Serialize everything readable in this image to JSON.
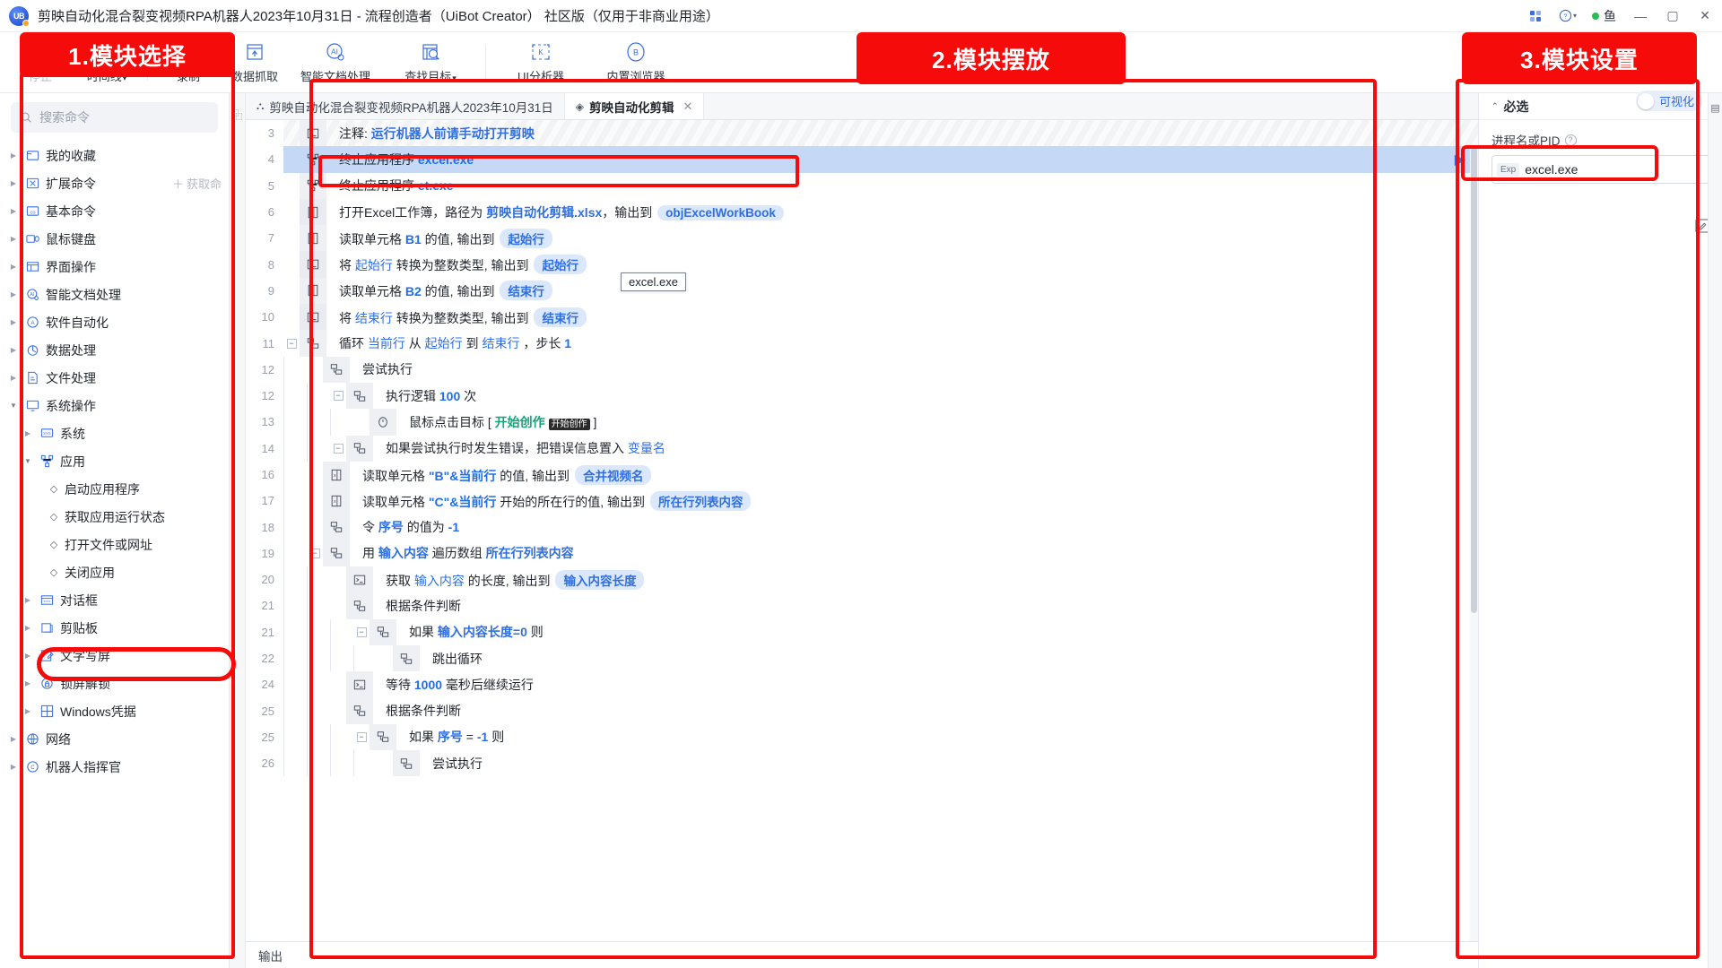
{
  "window": {
    "title": "剪映自动化混合裂变视频RPA机器人2023年10月31日 - 流程创造者（UiBot Creator） 社区版（仅用于非商业用途）",
    "logo_text": "UB",
    "user_label": "鱼",
    "minimize": "—",
    "maximize": "▢",
    "close": "✕",
    "help": "?",
    "help_caret": "▾",
    "grid_icon": "apps-grid-icon"
  },
  "toolbar": {
    "items": [
      {
        "label": "停止",
        "icon": "stop-icon",
        "disabled": true,
        "caret": false
      },
      {
        "label": "时间线",
        "icon": "timeline-icon",
        "disabled": false,
        "caret": true
      },
      {
        "label": "录制",
        "icon": "record-icon",
        "disabled": false,
        "caret": false
      },
      {
        "label": "数据抓取",
        "icon": "data-capture-icon",
        "disabled": false,
        "caret": false
      },
      {
        "label": "智能文档处理",
        "icon": "ai-document-icon",
        "disabled": false,
        "caret": false
      },
      {
        "label": "查找目标",
        "icon": "find-target-icon",
        "disabled": false,
        "caret": true
      },
      {
        "label": "UI分析器",
        "icon": "ui-analyzer-icon",
        "disabled": false,
        "caret": false
      },
      {
        "label": "内置浏览器",
        "icon": "browser-icon",
        "disabled": false,
        "caret": false
      }
    ]
  },
  "sidebar": {
    "search_placeholder": "搜索命令",
    "search_icon": "search-icon",
    "get_more_label": "获取命",
    "get_more_icon": "plus-icon",
    "items": [
      {
        "label": "我的收藏",
        "icon": "folder-icon",
        "depth": 0,
        "expanded": false,
        "leaf": false
      },
      {
        "label": "扩展命令",
        "icon": "extension-icon",
        "depth": 0,
        "expanded": false,
        "leaf": false,
        "get_more": true
      },
      {
        "label": "基本命令",
        "icon": "basic-icon",
        "depth": 0,
        "expanded": false,
        "leaf": false
      },
      {
        "label": "鼠标键盘",
        "icon": "mouse-keyboard-icon",
        "depth": 0,
        "expanded": false,
        "leaf": false
      },
      {
        "label": "界面操作",
        "icon": "ui-operation-icon",
        "depth": 0,
        "expanded": false,
        "leaf": false
      },
      {
        "label": "智能文档处理",
        "icon": "ai-document-icon",
        "depth": 0,
        "expanded": false,
        "leaf": false
      },
      {
        "label": "软件自动化",
        "icon": "software-auto-icon",
        "depth": 0,
        "expanded": false,
        "leaf": false
      },
      {
        "label": "数据处理",
        "icon": "data-process-icon",
        "depth": 0,
        "expanded": false,
        "leaf": false
      },
      {
        "label": "文件处理",
        "icon": "file-process-icon",
        "depth": 0,
        "expanded": false,
        "leaf": false
      },
      {
        "label": "系统操作",
        "icon": "system-icon",
        "depth": 0,
        "expanded": true,
        "leaf": false
      },
      {
        "label": "系统",
        "icon": "sys-icon",
        "depth": 1,
        "expanded": false,
        "leaf": false
      },
      {
        "label": "应用",
        "icon": "app-icon",
        "depth": 1,
        "expanded": true,
        "leaf": false
      },
      {
        "label": "启动应用程序",
        "icon": "diamond-icon",
        "depth": 2,
        "expanded": false,
        "leaf": true
      },
      {
        "label": "获取应用运行状态",
        "icon": "diamond-icon",
        "depth": 2,
        "expanded": false,
        "leaf": true
      },
      {
        "label": "打开文件或网址",
        "icon": "diamond-icon",
        "depth": 2,
        "expanded": false,
        "leaf": true
      },
      {
        "label": "关闭应用",
        "icon": "diamond-icon",
        "depth": 2,
        "expanded": false,
        "leaf": true,
        "highlighted": true
      },
      {
        "label": "对话框",
        "icon": "dialog-icon",
        "depth": 1,
        "expanded": false,
        "leaf": false
      },
      {
        "label": "剪贴板",
        "icon": "clipboard-icon",
        "depth": 1,
        "expanded": false,
        "leaf": false
      },
      {
        "label": "文字写屏",
        "icon": "text-screen-icon",
        "depth": 1,
        "expanded": false,
        "leaf": false
      },
      {
        "label": "锁屏解锁",
        "icon": "lock-screen-icon",
        "depth": 1,
        "expanded": false,
        "leaf": false
      },
      {
        "label": "Windows凭据",
        "icon": "windows-icon",
        "depth": 1,
        "expanded": false,
        "leaf": false
      },
      {
        "label": "网络",
        "icon": "network-icon",
        "depth": 0,
        "expanded": false,
        "leaf": false
      },
      {
        "label": "机器人指挥官",
        "icon": "commander-icon",
        "depth": 0,
        "expanded": false,
        "leaf": false
      }
    ]
  },
  "tabs": {
    "items": [
      {
        "label": "剪映自动化混合裂变视频RPA机器人2023年10月31日",
        "icon": "flow-tree-icon",
        "active": false,
        "closable": false
      },
      {
        "label": "剪映自动化剪辑",
        "icon": "stack-icon",
        "active": true,
        "closable": true,
        "close": "✕"
      }
    ]
  },
  "visualize": {
    "label": "可视化",
    "on": false
  },
  "tooltip": {
    "text": "excel.exe"
  },
  "flow": {
    "run_arrow": "▶",
    "rows": [
      {
        "num": "3",
        "indent": 0,
        "icon": "script-icon",
        "stripe": true,
        "parts": [
          {
            "t": "注释: ",
            "s": "n"
          },
          {
            "t": "运行机器人前请手动打开剪映",
            "s": "lnk-b"
          }
        ]
      },
      {
        "num": "4",
        "indent": 0,
        "icon": "app-icon",
        "selected": true,
        "parts": [
          {
            "t": "终止应用程序 ",
            "s": "n"
          },
          {
            "t": "excel.exe",
            "s": "b"
          }
        ]
      },
      {
        "num": "5",
        "indent": 0,
        "icon": "app-icon",
        "parts": [
          {
            "t": "终止应用程序 ",
            "s": "n"
          },
          {
            "t": "et.exe",
            "s": "b"
          }
        ]
      },
      {
        "num": "6",
        "indent": 0,
        "icon": "excel-icon",
        "alt": true,
        "parts": [
          {
            "t": "打开Excel工作簿，路径为 ",
            "s": "n"
          },
          {
            "t": "剪映自动化剪辑.xlsx",
            "s": "lnk-b"
          },
          {
            "t": "，输出到 ",
            "s": "n"
          },
          {
            "t": "objExcelWorkBook",
            "s": "chip"
          }
        ]
      },
      {
        "num": "7",
        "indent": 0,
        "icon": "excel-icon",
        "parts": [
          {
            "t": "读取单元格 ",
            "s": "n"
          },
          {
            "t": "B1",
            "s": "b"
          },
          {
            "t": " 的值, 输出到 ",
            "s": "n"
          },
          {
            "t": "起始行",
            "s": "chip"
          }
        ]
      },
      {
        "num": "8",
        "indent": 0,
        "icon": "script-icon",
        "alt": true,
        "parts": [
          {
            "t": "将 ",
            "s": "n"
          },
          {
            "t": "起始行",
            "s": "lnk"
          },
          {
            "t": " 转换为整数类型, 输出到 ",
            "s": "n"
          },
          {
            "t": "起始行",
            "s": "chip"
          }
        ]
      },
      {
        "num": "9",
        "indent": 0,
        "icon": "excel-icon",
        "parts": [
          {
            "t": "读取单元格 ",
            "s": "n"
          },
          {
            "t": "B2",
            "s": "b"
          },
          {
            "t": " 的值, 输出到 ",
            "s": "n"
          },
          {
            "t": "结束行",
            "s": "chip"
          }
        ]
      },
      {
        "num": "10",
        "indent": 0,
        "icon": "script-icon",
        "alt": true,
        "parts": [
          {
            "t": "将 ",
            "s": "n"
          },
          {
            "t": "结束行",
            "s": "lnk"
          },
          {
            "t": " 转换为整数类型, 输出到 ",
            "s": "n"
          },
          {
            "t": "结束行",
            "s": "chip"
          }
        ]
      },
      {
        "num": "11",
        "indent": 0,
        "icon": "logic-icon",
        "fold": "−",
        "foldIndent": 0,
        "parts": [
          {
            "t": "循环 ",
            "s": "n"
          },
          {
            "t": "当前行",
            "s": "lnk"
          },
          {
            "t": " 从 ",
            "s": "n"
          },
          {
            "t": "起始行",
            "s": "lnk"
          },
          {
            "t": " 到 ",
            "s": "n"
          },
          {
            "t": "结束行",
            "s": "lnk"
          },
          {
            "t": " ，步长 ",
            "s": "n"
          },
          {
            "t": "1",
            "s": "b"
          }
        ]
      },
      {
        "num": "12",
        "indent": 1,
        "icon": "logic-icon",
        "parts": [
          {
            "t": "尝试执行",
            "s": "n"
          }
        ]
      },
      {
        "num": "12",
        "indent": 2,
        "icon": "logic-icon",
        "fold": "−",
        "foldIndent": 2,
        "parts": [
          {
            "t": "执行逻辑 ",
            "s": "n"
          },
          {
            "t": "100",
            "s": "b"
          },
          {
            "t": " 次",
            "s": "n"
          }
        ]
      },
      {
        "num": "13",
        "indent": 3,
        "icon": "clock-icon",
        "parts": [
          {
            "t": "鼠标点击目标 [ ",
            "s": "n"
          },
          {
            "t": "开始创作",
            "s": "green"
          },
          {
            "t": " ",
            "s": "n"
          },
          {
            "t": "开始创作",
            "s": "blackchip"
          },
          {
            "t": " ]",
            "s": "n"
          }
        ]
      },
      {
        "num": "14",
        "indent": 2,
        "icon": "logic-icon",
        "fold": "−",
        "foldIndent": 2,
        "parts": [
          {
            "t": "如果尝试执行时发生错误，把错误信息置入 ",
            "s": "n"
          },
          {
            "t": "变量名",
            "s": "lnk"
          }
        ]
      },
      {
        "num": "16",
        "indent": 1,
        "icon": "excel-icon",
        "parts": [
          {
            "t": "读取单元格 ",
            "s": "n"
          },
          {
            "t": "\"B\"&当前行",
            "s": "b"
          },
          {
            "t": " 的值, 输出到 ",
            "s": "n"
          },
          {
            "t": "合并视频名",
            "s": "chip"
          }
        ]
      },
      {
        "num": "17",
        "indent": 1,
        "icon": "excel-icon",
        "parts": [
          {
            "t": "读取单元格 ",
            "s": "n"
          },
          {
            "t": "\"C\"&当前行",
            "s": "b"
          },
          {
            "t": " 开始的所在行的值, 输出到 ",
            "s": "n"
          },
          {
            "t": "所在行列表内容",
            "s": "chip"
          }
        ]
      },
      {
        "num": "18",
        "indent": 1,
        "icon": "logic-icon",
        "parts": [
          {
            "t": "令 ",
            "s": "n"
          },
          {
            "t": "序号",
            "s": "lnk-b"
          },
          {
            "t": " 的值为 ",
            "s": "n"
          },
          {
            "t": "-1",
            "s": "b"
          }
        ]
      },
      {
        "num": "19",
        "indent": 1,
        "icon": "logic-icon",
        "fold": "−",
        "foldIndent": 1,
        "parts": [
          {
            "t": "用 ",
            "s": "n"
          },
          {
            "t": "输入内容",
            "s": "lnk-b"
          },
          {
            "t": " 遍历数组 ",
            "s": "n"
          },
          {
            "t": "所在行列表内容",
            "s": "lnk-b"
          }
        ]
      },
      {
        "num": "20",
        "indent": 2,
        "icon": "script-icon",
        "parts": [
          {
            "t": "获取 ",
            "s": "n"
          },
          {
            "t": "输入内容",
            "s": "lnk"
          },
          {
            "t": " 的长度, 输出到 ",
            "s": "n"
          },
          {
            "t": "输入内容长度",
            "s": "chip"
          }
        ]
      },
      {
        "num": "21",
        "indent": 2,
        "icon": "logic-icon",
        "parts": [
          {
            "t": "根据条件判断",
            "s": "n"
          }
        ]
      },
      {
        "num": "21",
        "indent": 3,
        "icon": "logic-icon",
        "fold": "−",
        "foldIndent": 3,
        "parts": [
          {
            "t": "如果 ",
            "s": "n"
          },
          {
            "t": "输入内容长度=0",
            "s": "lnk-b"
          },
          {
            "t": " 则",
            "s": "n"
          }
        ]
      },
      {
        "num": "22",
        "indent": 4,
        "icon": "logic-icon",
        "parts": [
          {
            "t": "跳出循环",
            "s": "n"
          }
        ]
      },
      {
        "num": "24",
        "indent": 2,
        "icon": "script-icon",
        "parts": [
          {
            "t": "等待 ",
            "s": "n"
          },
          {
            "t": "1000",
            "s": "b"
          },
          {
            "t": " 毫秒后继续运行",
            "s": "n"
          }
        ]
      },
      {
        "num": "25",
        "indent": 2,
        "icon": "logic-icon",
        "parts": [
          {
            "t": "根据条件判断",
            "s": "n"
          }
        ]
      },
      {
        "num": "25",
        "indent": 3,
        "icon": "logic-icon",
        "fold": "−",
        "foldIndent": 3,
        "parts": [
          {
            "t": "如果 ",
            "s": "n"
          },
          {
            "t": "序号",
            "s": "lnk-b"
          },
          {
            "t": " = ",
            "s": "n"
          },
          {
            "t": "-1",
            "s": "lnk-b"
          },
          {
            "t": " 则",
            "s": "n"
          }
        ]
      },
      {
        "num": "26",
        "indent": 4,
        "icon": "logic-icon",
        "parts": [
          {
            "t": "尝试执行",
            "s": "n"
          }
        ]
      }
    ]
  },
  "output": {
    "label": "输出"
  },
  "properties": {
    "section_title": "必选",
    "section_chevron": "⌃",
    "field_label": "进程名或PID",
    "help_icon": "question-icon",
    "exp_tag": "Exp",
    "value": "excel.exe",
    "edit_icon": "edit-icon"
  },
  "annotations": {
    "box1": "1.模块选择",
    "box2": "2.模块摆放",
    "box3": "3.模块设置"
  },
  "colors": {
    "accent": "#2f6fe0",
    "annotation_red": "#f60b0b",
    "selection": "#c5d9f7",
    "chip_bg": "#dbe7fb",
    "green": "#1aa179"
  }
}
